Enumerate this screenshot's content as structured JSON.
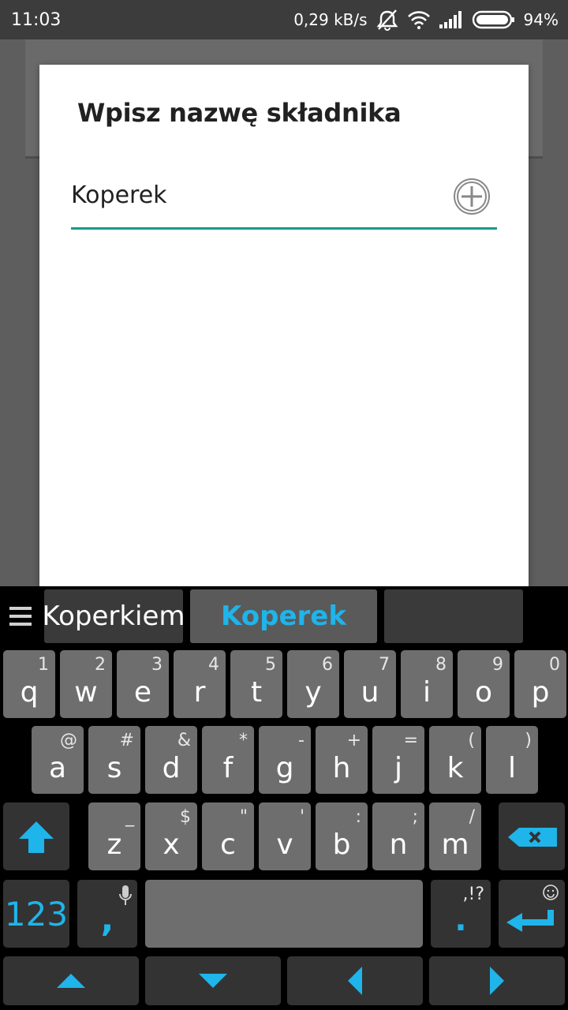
{
  "status_bar": {
    "time": "11:03",
    "speed": "0,29 kB/s",
    "battery": "94%"
  },
  "dialog": {
    "title": "Wpisz nazwę składnika",
    "input_value": "Koperek",
    "accent_color": "#1a9a8a"
  },
  "keyboard": {
    "suggestions": [
      "Koperkiem",
      "Koperek",
      ""
    ],
    "accent_color": "#1fb4ea",
    "row1": [
      {
        "key": "q",
        "alt": "1"
      },
      {
        "key": "w",
        "alt": "2"
      },
      {
        "key": "e",
        "alt": "3"
      },
      {
        "key": "r",
        "alt": "4"
      },
      {
        "key": "t",
        "alt": "5"
      },
      {
        "key": "y",
        "alt": "6"
      },
      {
        "key": "u",
        "alt": "7"
      },
      {
        "key": "i",
        "alt": "8"
      },
      {
        "key": "o",
        "alt": "9"
      },
      {
        "key": "p",
        "alt": "0"
      }
    ],
    "row2": [
      {
        "key": "a",
        "alt": "@"
      },
      {
        "key": "s",
        "alt": "#"
      },
      {
        "key": "d",
        "alt": "&"
      },
      {
        "key": "f",
        "alt": "*"
      },
      {
        "key": "g",
        "alt": "-"
      },
      {
        "key": "h",
        "alt": "+"
      },
      {
        "key": "j",
        "alt": "="
      },
      {
        "key": "k",
        "alt": "("
      },
      {
        "key": "l",
        "alt": ")"
      }
    ],
    "row3": [
      {
        "key": "z",
        "alt": "_"
      },
      {
        "key": "x",
        "alt": "$"
      },
      {
        "key": "c",
        "alt": "\""
      },
      {
        "key": "v",
        "alt": "'"
      },
      {
        "key": "b",
        "alt": ":"
      },
      {
        "key": "n",
        "alt": ";"
      },
      {
        "key": "m",
        "alt": "/"
      }
    ],
    "numbers_label": "123",
    "comma_label": ",",
    "period_label": ".",
    "period_alt": ",!?"
  }
}
